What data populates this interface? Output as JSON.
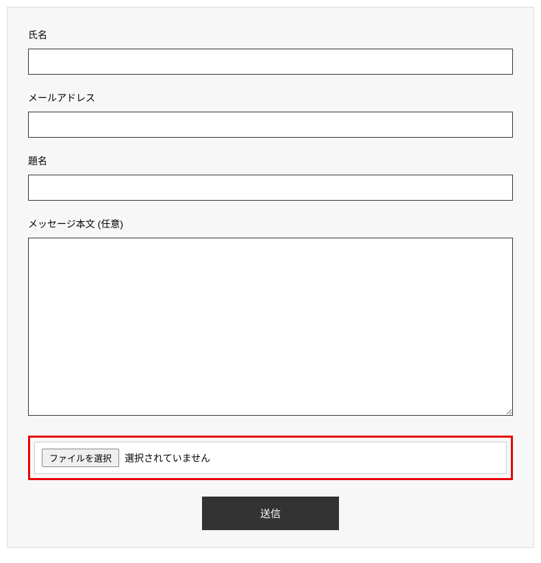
{
  "form": {
    "name": {
      "label": "氏名",
      "value": ""
    },
    "email": {
      "label": "メールアドレス",
      "value": ""
    },
    "subject": {
      "label": "題名",
      "value": ""
    },
    "message": {
      "label": "メッセージ本文 (任意)",
      "value": ""
    },
    "file": {
      "button_label": "ファイルを選択",
      "status_text": "選択されていません"
    },
    "submit": {
      "label": "送信"
    }
  }
}
